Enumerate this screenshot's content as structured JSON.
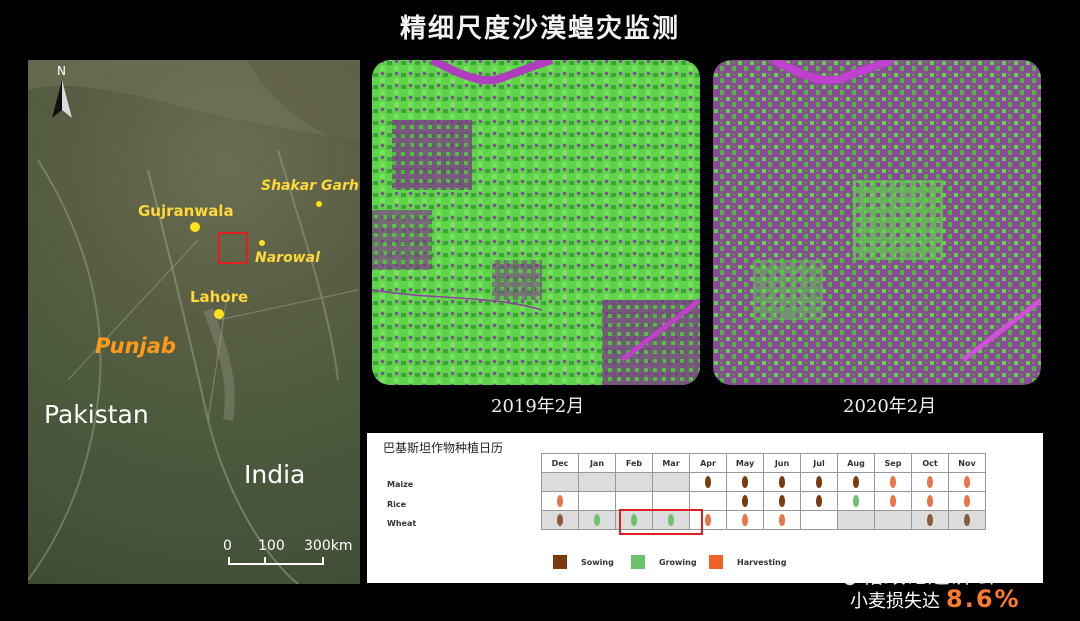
{
  "title": "精细尺度沙漠蝗灾监测",
  "map": {
    "north": "N",
    "cities": {
      "gujranwala": "Gujranwala",
      "shakargarh": "Shakar Garh",
      "narowal": "Narowal",
      "lahore": "Lahore"
    },
    "region": "Punjab",
    "countries": {
      "pakistan": "Pakistan",
      "india": "India"
    },
    "scale": {
      "t0": "0",
      "t1": "100",
      "t2": "300km"
    }
  },
  "panels": {
    "left_caption": "2019年2月",
    "right_caption": "2020年2月"
  },
  "calendar": {
    "title": "巴基斯坦作物种植日历",
    "months": [
      "Dec",
      "Jan",
      "Feb",
      "Mar",
      "Apr",
      "May",
      "Jun",
      "Jul",
      "Aug",
      "Sep",
      "Oct",
      "Nov"
    ],
    "crops": [
      "Maize",
      "Rice",
      "Wheat"
    ],
    "legend": {
      "sowing": "Sowing",
      "growing": "Growing",
      "harvesting": "Harvesting"
    },
    "colors": {
      "sowing": "#7a3a10",
      "growing": "#6cc16a",
      "harvesting": "#e8744a",
      "highlight": "#e02020"
    }
  },
  "watermark": "格致论道讲坛",
  "loss": {
    "label": "小麦损失达",
    "value": "8.6%"
  }
}
